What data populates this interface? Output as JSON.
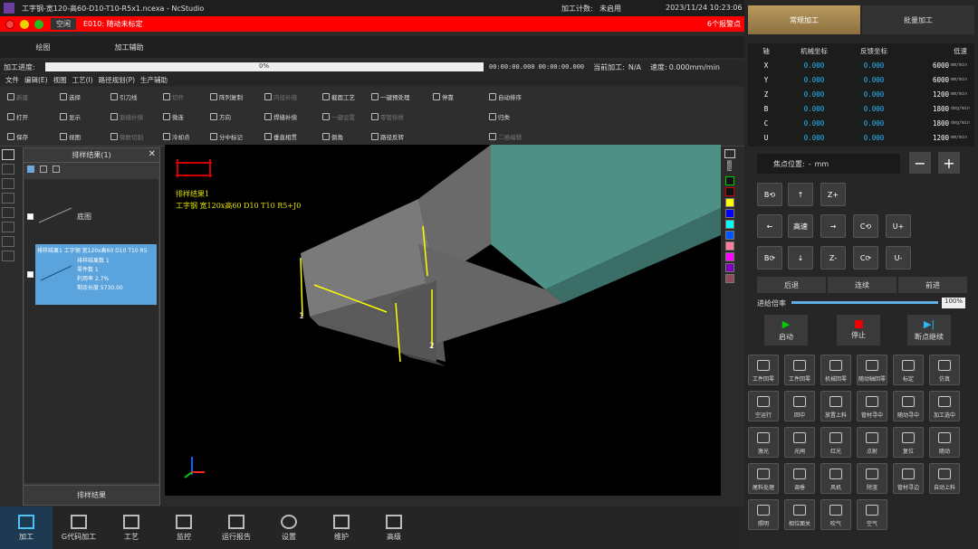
{
  "title": {
    "text": "工字钢-宽120-高60-D10-T10-R5x1.ncexa - NcStudio",
    "mode": "空闲",
    "counter_label": "加工计数:",
    "counter_value": "未启用",
    "datetime": "2023/11/24 10:23:06"
  },
  "alarm": {
    "text": "E010: 随动未标定",
    "count": "6个报警点"
  },
  "tabs": [
    "绘图",
    "加工辅助"
  ],
  "progress": {
    "label": "加工进度:",
    "percent_text": "0%",
    "fraction": 0.0,
    "time1": "00:00:00.000",
    "time2": "00:00:00.000",
    "current_label": "当前加工:",
    "current_value": "N/A",
    "speed_label": "速度:",
    "speed_value": "0.000mm/min"
  },
  "menu": [
    "文件",
    "编辑(E)",
    "视图",
    "工艺(I)",
    "路径规划(P)",
    "生产辅助"
  ],
  "toolbar": {
    "col1": [
      "新建",
      "打开",
      "保存"
    ],
    "col2": [
      "选择",
      "显示",
      "视图"
    ],
    "col3": [
      "引刀线",
      "割缝补偿",
      "微联切割"
    ],
    "col4": [
      "切杆",
      "微连",
      "冷却点"
    ],
    "col5": [
      "阵列复制",
      "方向",
      "分中标记"
    ],
    "col6": [
      "内径补偿",
      "焊缝补偿",
      "垂直相贯"
    ],
    "col7": [
      "截面工艺",
      "一键设置",
      "倒角"
    ],
    "col8": [
      "一键预处理",
      "零管排样",
      "路径反转"
    ],
    "col9": [
      "停靠"
    ],
    "col10": [
      "自动排序",
      "归类",
      "二维编辑"
    ]
  },
  "panel": {
    "title": "排样结果(1)",
    "item1_label": "底图",
    "item2_title": "排样结果1 工字钢 宽120x高60 D10 T10 R5",
    "item2_lines": [
      "排样结果数 1",
      "零件数 1",
      "利用率 2.7%",
      "剩余长度 5730.00"
    ],
    "footer": "排样结果"
  },
  "viewport": {
    "label1": "排样结果1",
    "label2": "工字钢 宽120x高60 D10 T10 R5+J0",
    "mark1": "1",
    "mark2": "2"
  },
  "legend": {
    "label": "图层",
    "colors": [
      "#ffff00",
      "#0000ff",
      "#00ffff",
      "#0055ff",
      "#ff7f9f",
      "#ff00ff",
      "#8000c0",
      "#8b4a5a"
    ]
  },
  "bottomnav": [
    "加工",
    "G代码加工",
    "工艺",
    "监控",
    "运行报告",
    "设置",
    "维护",
    "高级"
  ],
  "right": {
    "modes": [
      "常规加工",
      "批量加工"
    ],
    "axis_headers": [
      "轴",
      "机械坐标",
      "反馈坐标",
      "低速"
    ],
    "axes": [
      {
        "n": "X",
        "m": "0.000",
        "f": "0.000",
        "s": "6000",
        "u": "mm/min"
      },
      {
        "n": "Y",
        "m": "0.000",
        "f": "0.000",
        "s": "6000",
        "u": "mm/min"
      },
      {
        "n": "Z",
        "m": "0.000",
        "f": "0.000",
        "s": "1200",
        "u": "mm/min"
      },
      {
        "n": "B",
        "m": "0.000",
        "f": "0.000",
        "s": "1800",
        "u": "deg/min"
      },
      {
        "n": "C",
        "m": "0.000",
        "f": "0.000",
        "s": "1800",
        "u": "deg/min"
      },
      {
        "n": "U",
        "m": "0.000",
        "f": "0.000",
        "s": "1200",
        "u": "mm/min"
      }
    ],
    "focus_label": "焦点位置:",
    "focus_value": "-",
    "focus_unit": "mm",
    "jog": [
      "B⟲",
      "↑",
      "Z+",
      "←",
      "高速",
      "→",
      "C⟲",
      "U+",
      "B⟳",
      "↓",
      "Z-",
      "C⟳",
      "U-"
    ],
    "move": [
      "后退",
      "连续",
      "前进"
    ],
    "feed_label": "进给倍率",
    "feed_value": "100%",
    "feed_fraction": 1.0,
    "run": [
      "启动",
      "停止",
      "断点继续"
    ],
    "grid": [
      "工件回零",
      "工件回零",
      "机械回零",
      "随动轴回零",
      "标定",
      "仿真",
      "空运行",
      "回中",
      "放置上料",
      "管材寻中",
      "随动寻中",
      "加工选中",
      "激光",
      "光闸",
      "红光",
      "点射",
      "复位",
      "随动",
      "尾料处理",
      "调垂",
      "风机",
      "除渣",
      "管材寻边",
      "自动上料",
      "照明",
      "相位面关",
      "吹气",
      "空气"
    ]
  }
}
